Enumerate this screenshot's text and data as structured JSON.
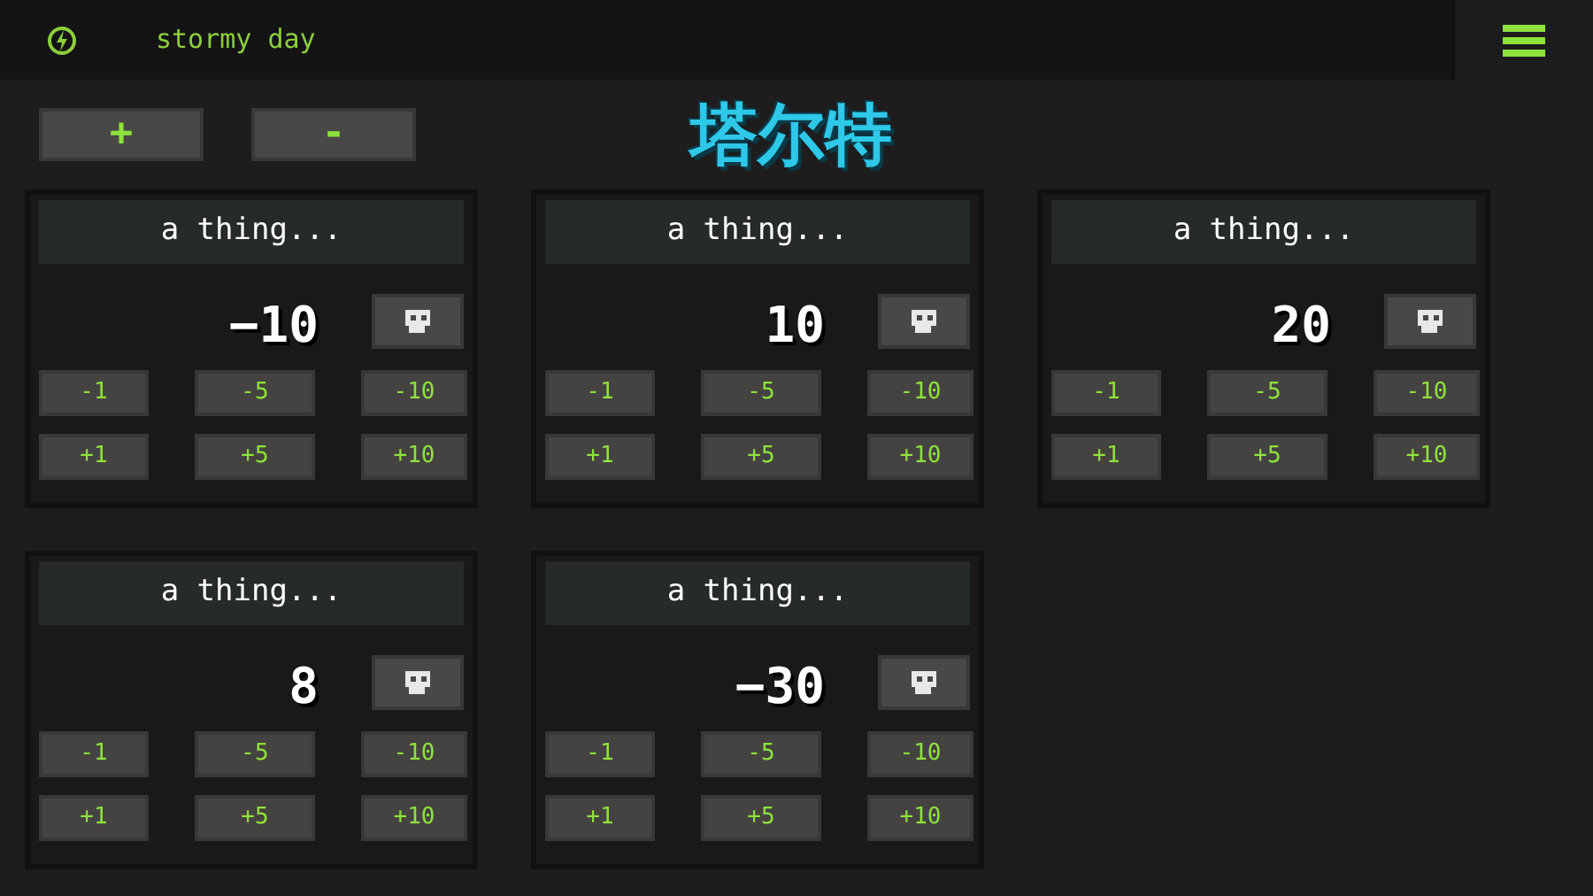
{
  "top_bar": {
    "weather": "stormy day"
  },
  "title": "塔尔特",
  "toolbar": [
    "+",
    "-"
  ],
  "counters": [
    {
      "name": "a thing...",
      "value": "−10",
      "minus": [
        "-1",
        "-5",
        "-10"
      ],
      "plus": [
        "+1",
        "+5",
        "+10"
      ]
    },
    {
      "name": "a thing...",
      "value": "10",
      "minus": [
        "-1",
        "-5",
        "-10"
      ],
      "plus": [
        "+1",
        "+5",
        "+10"
      ]
    },
    {
      "name": "a thing...",
      "value": "20",
      "minus": [
        "-1",
        "-5",
        "-10"
      ],
      "plus": [
        "+1",
        "+5",
        "+10"
      ]
    },
    {
      "name": "a thing...",
      "value": "8",
      "minus": [
        "-1",
        "-5",
        "-10"
      ],
      "plus": [
        "+1",
        "+5",
        "+10"
      ]
    },
    {
      "name": "a thing...",
      "value": "−30",
      "minus": [
        "-1",
        "-5",
        "-10"
      ],
      "plus": [
        "+1",
        "+5",
        "+10"
      ]
    }
  ]
}
